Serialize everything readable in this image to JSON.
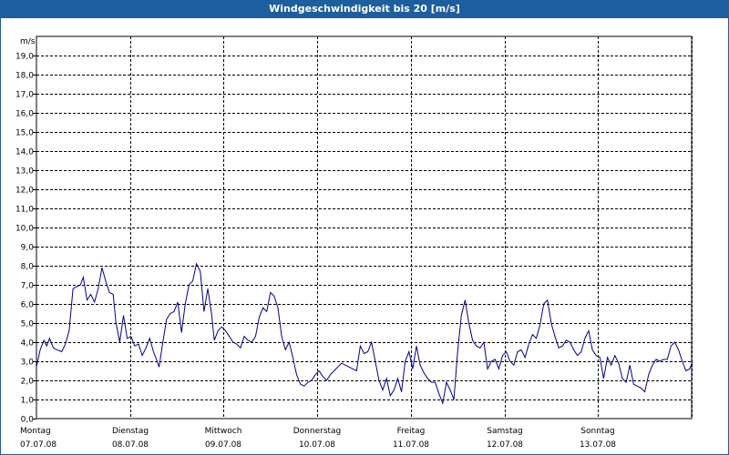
{
  "window": {
    "title": "Windgeschwindigkeit bis 20 [m/s]"
  },
  "colors": {
    "title_bar": "#1d5e9f",
    "series_line": "#00008b",
    "grid": "#000000"
  },
  "chart_data": {
    "type": "line",
    "title": "Windgeschwindigkeit bis 20 [m/s]",
    "ylabel": "m/s",
    "ylim": [
      0,
      20
    ],
    "yticks": [
      "0,0",
      "1,0",
      "2,0",
      "3,0",
      "4,0",
      "5,0",
      "6,0",
      "7,0",
      "8,0",
      "9,0",
      "10,0",
      "11,0",
      "12,0",
      "13,0",
      "14,0",
      "15,0",
      "16,0",
      "17,0",
      "18,0",
      "19,0"
    ],
    "xlim_days": [
      0,
      7
    ],
    "x_day_labels": [
      {
        "day": "Montag",
        "date": "07.07.08"
      },
      {
        "day": "Dienstag",
        "date": "08.07.08"
      },
      {
        "day": "Mittwoch",
        "date": "09.07.08"
      },
      {
        "day": "Donnerstag",
        "date": "10.07.08"
      },
      {
        "day": "Freitag",
        "date": "11.07.08"
      },
      {
        "day": "Samstag",
        "date": "12.07.08"
      },
      {
        "day": "Sonntag",
        "date": "13.07.08"
      }
    ],
    "grid": true,
    "series": [
      {
        "points": [
          [
            0.0,
            2.7
          ],
          [
            0.04,
            3.6
          ],
          [
            0.08,
            4.1
          ],
          [
            0.11,
            3.8
          ],
          [
            0.14,
            4.2
          ],
          [
            0.18,
            3.7
          ],
          [
            0.22,
            3.6
          ],
          [
            0.27,
            3.5
          ],
          [
            0.31,
            3.9
          ],
          [
            0.35,
            4.6
          ],
          [
            0.39,
            6.8
          ],
          [
            0.43,
            6.9
          ],
          [
            0.47,
            7.0
          ],
          [
            0.5,
            7.4
          ],
          [
            0.54,
            6.2
          ],
          [
            0.58,
            6.5
          ],
          [
            0.62,
            6.1
          ],
          [
            0.66,
            6.8
          ],
          [
            0.7,
            7.9
          ],
          [
            0.74,
            7.2
          ],
          [
            0.78,
            6.6
          ],
          [
            0.82,
            6.5
          ],
          [
            0.85,
            5.0
          ],
          [
            0.89,
            4.0
          ],
          [
            0.93,
            5.4
          ],
          [
            0.97,
            4.2
          ],
          [
            1.01,
            4.3
          ],
          [
            1.05,
            3.8
          ],
          [
            1.09,
            3.9
          ],
          [
            1.13,
            3.3
          ],
          [
            1.17,
            3.7
          ],
          [
            1.21,
            4.2
          ],
          [
            1.25,
            3.5
          ],
          [
            1.29,
            3.0
          ],
          [
            1.31,
            2.7
          ],
          [
            1.35,
            4.0
          ],
          [
            1.39,
            5.2
          ],
          [
            1.43,
            5.5
          ],
          [
            1.47,
            5.6
          ],
          [
            1.51,
            6.1
          ],
          [
            1.55,
            4.5
          ],
          [
            1.59,
            6.0
          ],
          [
            1.63,
            7.0
          ],
          [
            1.67,
            7.2
          ],
          [
            1.71,
            8.1
          ],
          [
            1.75,
            7.7
          ],
          [
            1.79,
            5.6
          ],
          [
            1.83,
            6.8
          ],
          [
            1.87,
            5.5
          ],
          [
            1.9,
            4.1
          ],
          [
            1.94,
            4.6
          ],
          [
            1.98,
            4.8
          ],
          [
            2.02,
            4.6
          ],
          [
            2.06,
            4.3
          ],
          [
            2.1,
            4.0
          ],
          [
            2.14,
            3.9
          ],
          [
            2.18,
            3.7
          ],
          [
            2.22,
            4.3
          ],
          [
            2.26,
            4.1
          ],
          [
            2.3,
            4.0
          ],
          [
            2.34,
            4.3
          ],
          [
            2.38,
            5.3
          ],
          [
            2.42,
            5.8
          ],
          [
            2.46,
            5.6
          ],
          [
            2.5,
            6.6
          ],
          [
            2.54,
            6.4
          ],
          [
            2.58,
            5.8
          ],
          [
            2.62,
            4.3
          ],
          [
            2.66,
            3.6
          ],
          [
            2.7,
            4.0
          ],
          [
            2.74,
            3.2
          ],
          [
            2.78,
            2.3
          ],
          [
            2.82,
            1.8
          ],
          [
            2.86,
            1.7
          ],
          [
            2.9,
            1.9
          ],
          [
            2.94,
            2.0
          ],
          [
            2.98,
            2.3
          ],
          [
            3.02,
            2.5
          ],
          [
            3.06,
            2.2
          ],
          [
            3.1,
            2.0
          ],
          [
            3.14,
            2.3
          ],
          [
            3.18,
            2.5
          ],
          [
            3.22,
            2.7
          ],
          [
            3.26,
            2.9
          ],
          [
            3.3,
            2.8
          ],
          [
            3.34,
            2.7
          ],
          [
            3.38,
            2.6
          ],
          [
            3.42,
            2.5
          ],
          [
            3.46,
            3.8
          ],
          [
            3.5,
            3.4
          ],
          [
            3.54,
            3.5
          ],
          [
            3.58,
            4.0
          ],
          [
            3.62,
            3.0
          ],
          [
            3.66,
            2.0
          ],
          [
            3.7,
            1.5
          ],
          [
            3.74,
            2.1
          ],
          [
            3.78,
            1.2
          ],
          [
            3.82,
            1.5
          ],
          [
            3.86,
            2.1
          ],
          [
            3.9,
            1.4
          ],
          [
            3.94,
            3.0
          ],
          [
            3.98,
            3.5
          ],
          [
            4.02,
            2.6
          ],
          [
            4.06,
            3.8
          ],
          [
            4.1,
            2.8
          ],
          [
            4.14,
            2.4
          ],
          [
            4.18,
            2.1
          ],
          [
            4.22,
            1.9
          ],
          [
            4.26,
            1.9
          ],
          [
            4.3,
            1.3
          ],
          [
            4.34,
            0.8
          ],
          [
            4.38,
            1.9
          ],
          [
            4.42,
            1.5
          ],
          [
            4.46,
            1.0
          ],
          [
            4.5,
            3.5
          ],
          [
            4.54,
            5.4
          ],
          [
            4.58,
            6.2
          ],
          [
            4.62,
            5.0
          ],
          [
            4.66,
            4.1
          ],
          [
            4.7,
            3.8
          ],
          [
            4.74,
            3.7
          ],
          [
            4.78,
            4.0
          ],
          [
            4.82,
            2.6
          ],
          [
            4.86,
            3.0
          ],
          [
            4.9,
            3.1
          ],
          [
            4.94,
            2.6
          ],
          [
            4.98,
            3.3
          ],
          [
            5.02,
            3.5
          ],
          [
            5.06,
            3.0
          ],
          [
            5.1,
            2.8
          ],
          [
            5.14,
            3.5
          ],
          [
            5.18,
            3.6
          ],
          [
            5.22,
            3.2
          ],
          [
            5.26,
            3.9
          ],
          [
            5.3,
            4.4
          ],
          [
            5.34,
            4.2
          ],
          [
            5.38,
            4.9
          ],
          [
            5.42,
            6.0
          ],
          [
            5.46,
            6.2
          ],
          [
            5.5,
            5.0
          ],
          [
            5.54,
            4.3
          ],
          [
            5.58,
            3.7
          ],
          [
            5.62,
            3.8
          ],
          [
            5.66,
            4.1
          ],
          [
            5.7,
            4.0
          ],
          [
            5.74,
            3.6
          ],
          [
            5.78,
            3.3
          ],
          [
            5.82,
            3.5
          ],
          [
            5.86,
            4.2
          ],
          [
            5.9,
            4.6
          ],
          [
            5.94,
            3.6
          ],
          [
            5.98,
            3.3
          ],
          [
            6.02,
            3.2
          ],
          [
            6.06,
            2.1
          ],
          [
            6.1,
            3.2
          ],
          [
            6.14,
            2.8
          ],
          [
            6.18,
            3.3
          ],
          [
            6.22,
            2.9
          ],
          [
            6.26,
            2.1
          ],
          [
            6.3,
            1.9
          ],
          [
            6.34,
            2.8
          ],
          [
            6.38,
            1.8
          ],
          [
            6.42,
            1.7
          ],
          [
            6.46,
            1.6
          ],
          [
            6.5,
            1.4
          ],
          [
            6.54,
            2.3
          ],
          [
            6.58,
            2.8
          ],
          [
            6.62,
            3.1
          ],
          [
            6.66,
            3.0
          ],
          [
            6.7,
            3.1
          ],
          [
            6.74,
            3.1
          ],
          [
            6.78,
            3.8
          ],
          [
            6.82,
            4.0
          ],
          [
            6.86,
            3.6
          ],
          [
            6.9,
            3.0
          ],
          [
            6.94,
            2.5
          ],
          [
            6.98,
            2.6
          ],
          [
            7.01,
            3.0
          ]
        ]
      }
    ]
  }
}
